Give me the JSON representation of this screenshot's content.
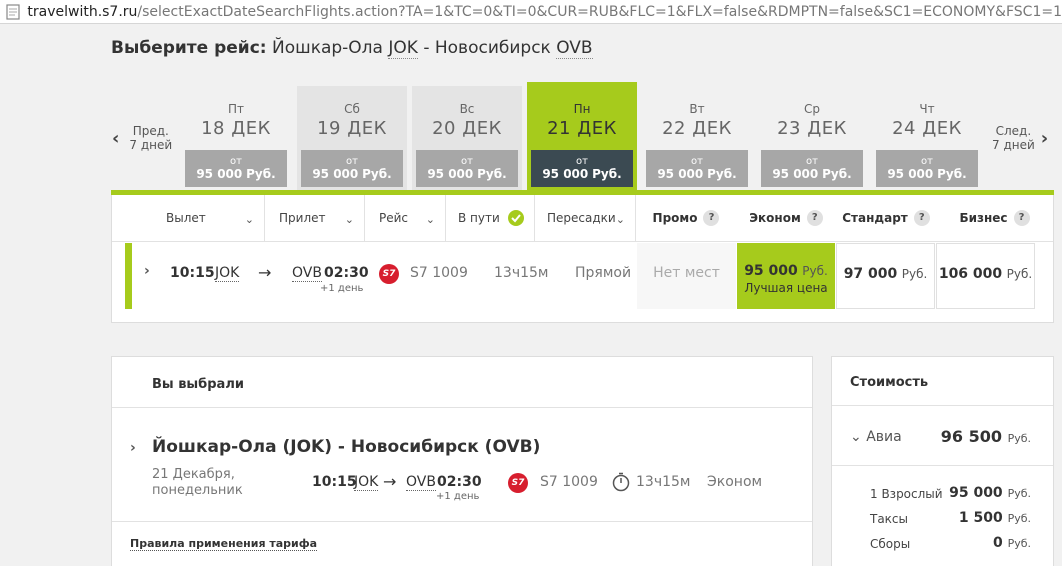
{
  "browser": {
    "url_host": "travelwith.s7.ru",
    "url_path": "/selectExactDateSearchFlights.action?TA=1&TC=0&TI=0&CUR=RUB&FLC=1&FLX=false&RDMPTN=false&SC1=ECONOMY&FSC1=1"
  },
  "title": {
    "prefix": "Выберите рейс:",
    "from_city": "Йошкар-Ола",
    "from_code": "JOK",
    "sep": "-",
    "to_city": "Новосибирск",
    "to_code": "OVB"
  },
  "nav": {
    "prev_line1": "Пред.",
    "prev_line2": "7 дней",
    "next_line1": "След.",
    "next_line2": "7 дней"
  },
  "days": [
    {
      "dow": "Пт",
      "date": "18 ДЕК",
      "ot": "от",
      "price": "95 000",
      "cur": "Руб.",
      "state": "normal"
    },
    {
      "dow": "Сб",
      "date": "19 ДЕК",
      "ot": "от",
      "price": "95 000",
      "cur": "Руб.",
      "state": "weekend"
    },
    {
      "dow": "Вс",
      "date": "20 ДЕК",
      "ot": "от",
      "price": "95 000",
      "cur": "Руб.",
      "state": "weekend"
    },
    {
      "dow": "Пн",
      "date": "21 ДЕК",
      "ot": "от",
      "price": "95 000",
      "cur": "Руб.",
      "state": "selected"
    },
    {
      "dow": "Вт",
      "date": "22 ДЕК",
      "ot": "от",
      "price": "95 000",
      "cur": "Руб.",
      "state": "normal"
    },
    {
      "dow": "Ср",
      "date": "23 ДЕК",
      "ot": "от",
      "price": "95 000",
      "cur": "Руб.",
      "state": "normal"
    },
    {
      "dow": "Чт",
      "date": "24 ДЕК",
      "ot": "от",
      "price": "95 000",
      "cur": "Руб.",
      "state": "normal"
    }
  ],
  "columns": {
    "depart": "Вылет",
    "arrive": "Прилет",
    "flight": "Рейс",
    "duration": "В пути",
    "stops": "Пересадки",
    "promo": "Промо",
    "economy": "Эконом",
    "standard": "Стандарт",
    "business": "Бизнес",
    "help": "?"
  },
  "flight": {
    "dep_time": "10:15",
    "dep_code": "JOK",
    "arrow": "→",
    "arr_code": "OVB",
    "arr_time": "02:30",
    "next_day": "+1 день",
    "airline_logo": "S7",
    "flight_no": "S7 1009",
    "duration": "13ч15м",
    "stops": "Прямой",
    "promo": "Нет мест",
    "economy_price": "95 000",
    "economy_note": "Лучшая цена",
    "standard_price": "97 000",
    "business_price": "106 000",
    "cur": "Руб."
  },
  "selected": {
    "header": "Вы выбрали",
    "route": "Йошкар-Ола (JOK) - Новосибирск (OVB)",
    "date_line1": "21 Декабря,",
    "date_line2": "понедельник",
    "dep_time": "10:15",
    "dep_code": "JOK",
    "arrow": "→",
    "arr_code": "OVB",
    "arr_time": "02:30",
    "next_day": "+1 день",
    "flight_no": "S7 1009",
    "duration": "13ч15м",
    "fare_class": "Эконом",
    "tarif_rules": "Правила применения тарифа"
  },
  "cost": {
    "header": "Стоимость",
    "avia_label": "Авиа",
    "avia_total": "96 500",
    "cur": "Руб.",
    "lines": [
      {
        "label": "1 Взрослый",
        "value": "95 000"
      },
      {
        "label": "Таксы",
        "value": "1 500"
      },
      {
        "label": "Сборы",
        "value": "0"
      }
    ]
  },
  "colors": {
    "accent_green": "#a6cb1c",
    "selected_price_bg": "#3b4a52",
    "s7_red": "#d71e2e"
  }
}
